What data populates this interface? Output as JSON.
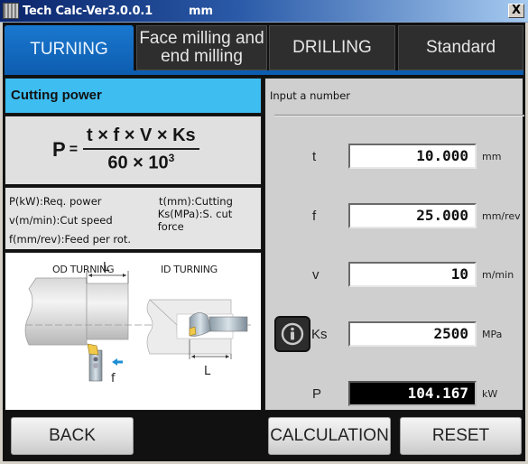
{
  "window": {
    "title": "Tech Calc-Ver3.0.0.1",
    "unit_mode": "mm",
    "close_label": "X"
  },
  "tabs": [
    {
      "label": "TURNING",
      "active": true
    },
    {
      "label": "Face milling and end milling",
      "line1": "Face milling and",
      "line2": "end milling",
      "active": false
    },
    {
      "label": "DRILLING",
      "active": false
    },
    {
      "label": "Standard",
      "active": false
    }
  ],
  "left_panel": {
    "header": "Cutting power",
    "formula": {
      "lhs": "P",
      "eq": "=",
      "numerator": "t × f × V × Ks",
      "denominator_base": "60 × 10",
      "denominator_exp": "3"
    },
    "legend": [
      [
        "P(kW):Req. power",
        "t(mm):Cutting"
      ],
      [
        "v(m/min):Cut speed",
        "Ks(MPa):S. cut force"
      ],
      [
        "f(mm/rev):Feed per rot.",
        ""
      ]
    ],
    "diagram": {
      "od_label": "OD TURNING",
      "id_label": "ID TURNING",
      "length_label": "L",
      "feed_label": "f"
    }
  },
  "right_panel": {
    "prompt": "Input a number",
    "fields": [
      {
        "label": "t",
        "value": "10.000",
        "unit": "mm"
      },
      {
        "label": "f",
        "value": "25.000",
        "unit": "mm/rev"
      },
      {
        "label": "v",
        "value": "10",
        "unit": "m/min"
      },
      {
        "label": "Ks",
        "value": "2500",
        "unit": "MPa"
      },
      {
        "label": "P",
        "value": "104.167",
        "unit": "kW",
        "result": true
      }
    ],
    "info_icon": "info-icon"
  },
  "buttons": {
    "back": "BACK",
    "calculation": "CALCULATION",
    "reset": "RESET"
  },
  "colors": {
    "accent_blue": "#0d5db0",
    "header_cyan": "#3ebdf0",
    "result_bg": "#000000"
  }
}
